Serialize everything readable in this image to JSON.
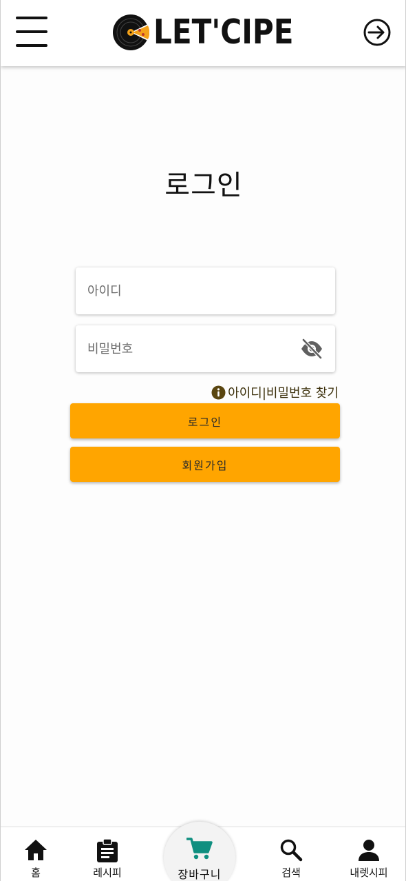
{
  "header": {
    "logo_text": "LET'CIPE"
  },
  "login": {
    "title": "로그인",
    "id_placeholder": "아이디",
    "password_placeholder": "비밀번호",
    "find_link": "아이디|비밀번호 찾기",
    "login_button": "로그인",
    "signup_button": "회원가입"
  },
  "colors": {
    "accent": "#ffa500",
    "cart_icon": "#0f8f80"
  },
  "bottom_nav": {
    "items": [
      {
        "label": "홈",
        "icon": "home-icon"
      },
      {
        "label": "레시피",
        "icon": "clipboard-icon"
      },
      {
        "label": "장바구니",
        "icon": "cart-icon"
      },
      {
        "label": "검색",
        "icon": "search-icon"
      },
      {
        "label": "내렛시피",
        "icon": "person-icon"
      }
    ]
  }
}
